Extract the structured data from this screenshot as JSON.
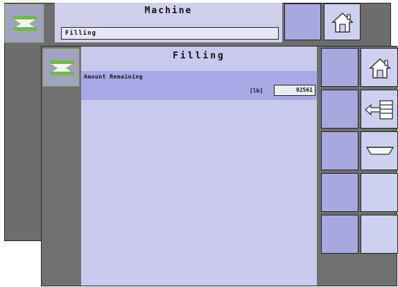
{
  "back_screen": {
    "title": "Machine",
    "field_value": "Filling",
    "logo_icon": "sprayer-icon",
    "home_icon": "home-icon"
  },
  "front_screen": {
    "title": "Filling",
    "logo_icon": "sprayer-icon",
    "amount": {
      "label": "Amount Remaining",
      "unit": "[lb]",
      "value": "92561"
    },
    "side_icons": [
      "home-icon",
      "tank-fill-icon",
      "tank-icon"
    ]
  },
  "colors": {
    "panel_light": "#c9c9ee",
    "panel_row": "#a8a8e6",
    "button": "#a8a8e0",
    "frame": "#707070",
    "logo_green": "#6fbf2f"
  }
}
